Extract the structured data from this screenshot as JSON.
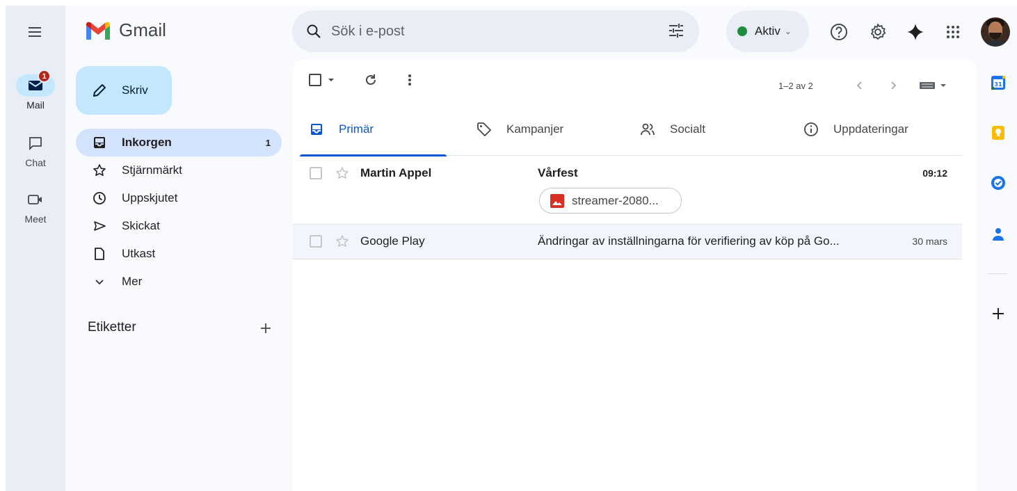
{
  "app": {
    "title": "Gmail"
  },
  "rail": {
    "items": [
      {
        "label": "Mail",
        "badge": "1",
        "active": true
      },
      {
        "label": "Chat"
      },
      {
        "label": "Meet"
      }
    ]
  },
  "search": {
    "placeholder": "Sök i e-post"
  },
  "status": {
    "label": "Aktiv",
    "color": "#1e8e3e"
  },
  "compose": {
    "label": "Skriv"
  },
  "nav": {
    "items": [
      {
        "label": "Inkorgen",
        "count": "1",
        "icon": "inbox-icon"
      },
      {
        "label": "Stjärnmärkt",
        "icon": "star-icon"
      },
      {
        "label": "Uppskjutet",
        "icon": "clock-icon"
      },
      {
        "label": "Skickat",
        "icon": "send-icon"
      },
      {
        "label": "Utkast",
        "icon": "draft-icon"
      },
      {
        "label": "Mer",
        "icon": "chevron-down-icon"
      }
    ]
  },
  "labels": {
    "heading": "Etiketter"
  },
  "toolbar": {
    "pager": "1–2 av 2"
  },
  "tabs": [
    {
      "label": "Primär",
      "icon": "inbox-icon"
    },
    {
      "label": "Kampanjer",
      "icon": "tag-icon"
    },
    {
      "label": "Socialt",
      "icon": "people-icon"
    },
    {
      "label": "Uppdateringar",
      "icon": "info-icon"
    }
  ],
  "emails": [
    {
      "sender": "Martin Appel",
      "subject": "Vårfest",
      "time": "09:12",
      "unread": true,
      "attachment": "streamer-2080..."
    },
    {
      "sender": "Google Play",
      "subject": "Ändringar av inställningarna för verifiering av köp på Go...",
      "time": "30 mars",
      "unread": false
    }
  ],
  "colors": {
    "accent": "#0b57d0",
    "compose": "#c2e7ff",
    "nav_active": "#d3e3fd",
    "badge": "#b3261e"
  }
}
